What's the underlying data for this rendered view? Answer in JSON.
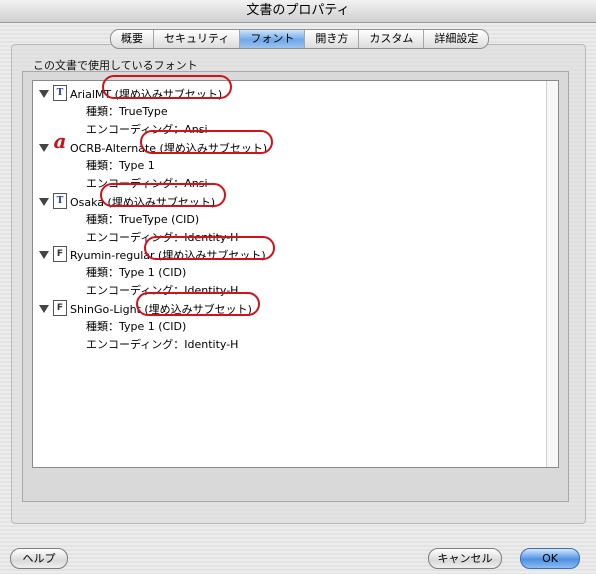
{
  "window": {
    "title": "文書のプロパティ"
  },
  "tabs": [
    {
      "label": "概要"
    },
    {
      "label": "セキュリティ"
    },
    {
      "label": "フォント"
    },
    {
      "label": "開き方"
    },
    {
      "label": "カスタム"
    },
    {
      "label": "詳細設定"
    }
  ],
  "active_tab": "フォント",
  "section_label": "この文書で使用しているフォント",
  "fonts": [
    {
      "name": "ArialMT (埋め込みサブセット)",
      "icon": "truetype-font-icon",
      "type_line": "種類：TrueType",
      "encoding_line": "エンコーディング：Ansi"
    },
    {
      "name": "OCRB-Alternate (埋め込みサブセット)",
      "icon": "adobe-type1-font-icon",
      "type_line": "種類：Type 1",
      "encoding_line": "エンコーディング：Ansi"
    },
    {
      "name": "Osaka (埋め込みサブセット)",
      "icon": "truetype-font-icon",
      "type_line": "種類：TrueType (CID)",
      "encoding_line": "エンコーディング：Identity-H"
    },
    {
      "name": "Ryumin-regular (埋め込みサブセット)",
      "icon": "font-file-icon",
      "type_line": "種類：Type 1 (CID)",
      "encoding_line": "エンコーディング：Identity-H"
    },
    {
      "name": "ShinGo-Light (埋め込みサブセット)",
      "icon": "font-file-icon",
      "type_line": "種類：Type 1 (CID)",
      "encoding_line": "エンコーディング：Identity-H"
    }
  ],
  "buttons": {
    "help": "ヘルプ",
    "cancel": "キャンセル",
    "ok": "OK"
  },
  "colors": {
    "highlight_circle": "#d2121b",
    "active_tab": "#6fa8e8"
  }
}
